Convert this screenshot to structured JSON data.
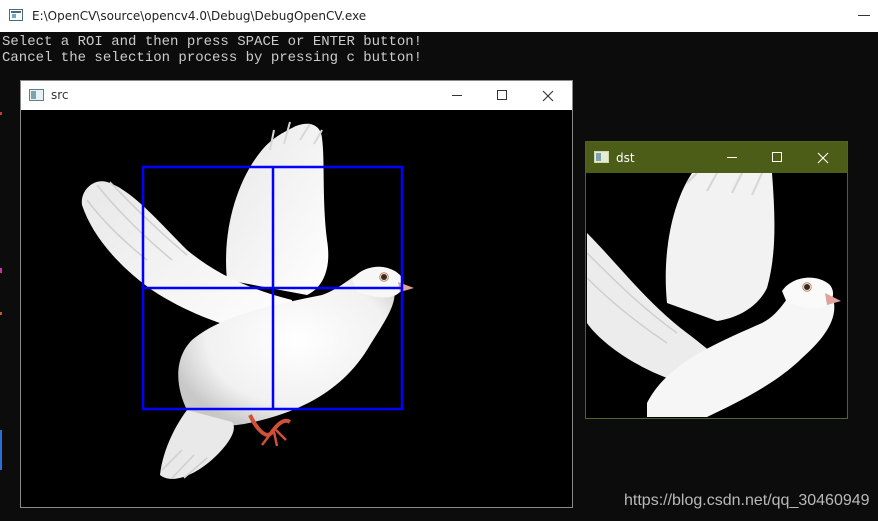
{
  "console": {
    "window_title": "E:\\OpenCV\\source\\opencv4.0\\Debug\\DebugOpenCV.exe",
    "lines": [
      "Select a ROI and then press SPACE or ENTER button!",
      "Cancel the selection process by pressing c button!"
    ]
  },
  "src_window": {
    "title": "src",
    "image": "white-dove-flying-on-black-background"
  },
  "dst_window": {
    "title": "dst",
    "image": "cropped-white-dove-roi"
  },
  "selection": {
    "color": "#0000ff",
    "grid": "2x2"
  },
  "colors": {
    "console_bg": "#0c0c0c",
    "console_text": "#cccccc",
    "dst_titlebar": "#4b5d17",
    "roi_stroke": "#0000ff"
  },
  "watermark": "https://blog.csdn.net/qq_30460949"
}
